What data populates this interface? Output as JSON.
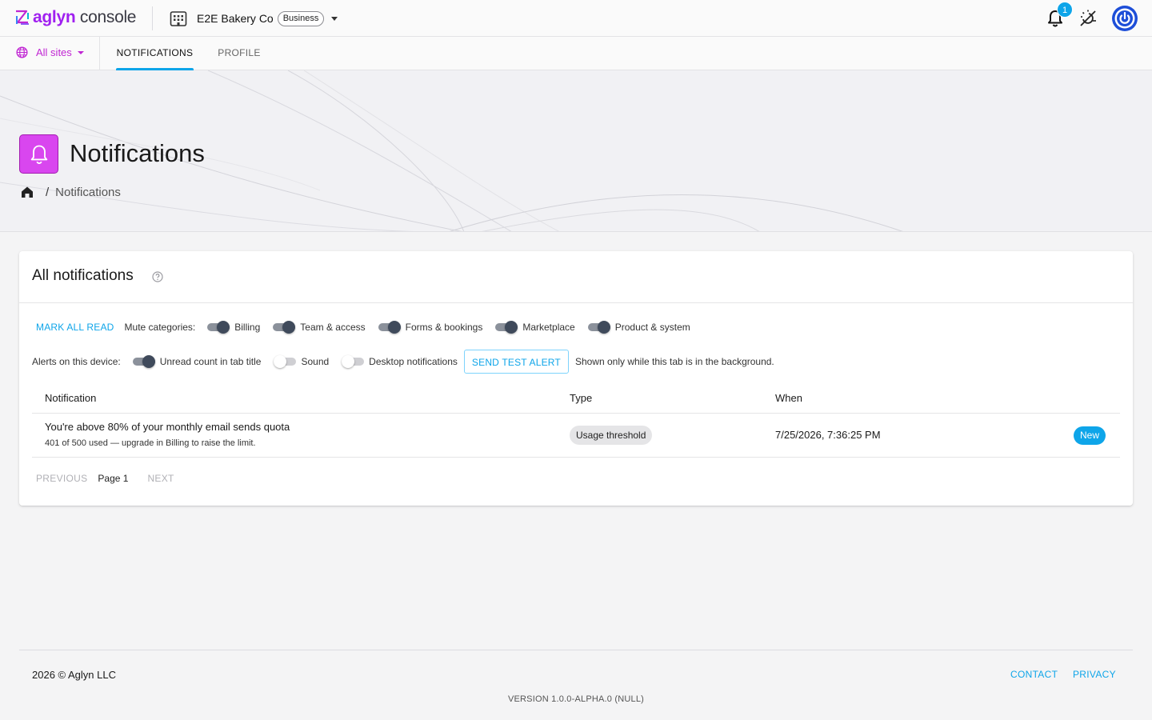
{
  "header": {
    "brand": "aglyn",
    "product": "console",
    "org_name": "E2E Bakery Co",
    "org_plan": "Business",
    "notification_count": "1",
    "icons": [
      "logo-mark",
      "building-icon",
      "chevron-down-icon",
      "bell-icon",
      "theme-toggle-icon",
      "power-icon"
    ]
  },
  "subnav": {
    "sites_label": "All sites",
    "tabs": [
      {
        "label": "NOTIFICATIONS",
        "active": true
      },
      {
        "label": "PROFILE",
        "active": false
      }
    ]
  },
  "hero": {
    "title": "Notifications",
    "breadcrumb_separator": "/",
    "breadcrumb_current": "Notifications",
    "icon_color": "#d946ef"
  },
  "card": {
    "title": "All notifications",
    "mark_all_read": "MARK ALL READ",
    "mute_label": "Mute categories:",
    "categories": [
      {
        "label": "Billing",
        "on": true
      },
      {
        "label": "Team & access",
        "on": true
      },
      {
        "label": "Forms & bookings",
        "on": true
      },
      {
        "label": "Marketplace",
        "on": true
      },
      {
        "label": "Product & system",
        "on": true
      }
    ],
    "device_label": "Alerts on this device:",
    "device_toggles": [
      {
        "label": "Unread count in tab title",
        "on": true
      },
      {
        "label": "Sound",
        "on": false
      },
      {
        "label": "Desktop notifications",
        "on": false
      }
    ],
    "send_test_alert": "SEND TEST ALERT",
    "background_note": "Shown only while this tab is in the background.",
    "columns": [
      "Notification",
      "Type",
      "When"
    ],
    "rows": [
      {
        "title": "You're above 80% of your monthly email sends quota",
        "subtitle": "401 of 500 used — upgrade in Billing to raise the limit.",
        "type": "Usage threshold",
        "when": "7/25/2026, 7:36:25 PM",
        "status": "New"
      }
    ],
    "pager": {
      "previous": "PREVIOUS",
      "page": "Page 1",
      "next": "NEXT"
    }
  },
  "footer": {
    "copyright": "2026 © Aglyn LLC",
    "contact": "CONTACT",
    "privacy": "PRIVACY",
    "version": "VERSION 1.0.0-ALPHA.0 (NULL)"
  },
  "colors": {
    "accent": "#0ea5e9",
    "brand": "#a020f0",
    "sites": "#c026d3",
    "toggle_on": "#3f4a5b"
  }
}
